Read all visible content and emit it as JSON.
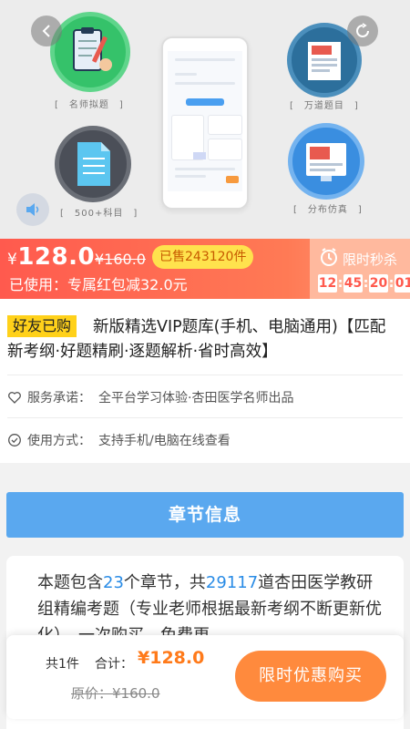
{
  "banner": {
    "captions": [
      "[　名师拟题　]",
      "[　万道题目　]",
      "[　500+科目　]",
      "[　分布仿真　]"
    ]
  },
  "price": {
    "current_symbol": "¥",
    "current_value": "128.0",
    "original": "¥160.0",
    "sold_badge": "已售243120件",
    "coupon_text": "已使用：专属红包减32.0元"
  },
  "flash_sale": {
    "title": "限时秒杀",
    "countdown": [
      "12",
      "45",
      "20",
      "01"
    ]
  },
  "product": {
    "friend_tag": "好友已购",
    "title": "新版精选VIP题库(手机、电脑通用)【匹配新考纲·好题精刷·逐题解析·省时高效】",
    "service_label": "服务承诺：",
    "service_value": "全平台学习体验·杏田医学名师出品",
    "usage_label": "使用方式：",
    "usage_value": "支持手机/电脑在线查看"
  },
  "chapter_button": "章节信息",
  "description": {
    "p1": "本题包含",
    "chapters": "23",
    "p2": "个章节，共",
    "questions": "29117",
    "p3": "道杏田医学教研组精编考题（专业老师根据最新考纲不断更新优化），一次购买，免费更"
  },
  "bottom_bar": {
    "count": "共1件",
    "total_label": "合计：",
    "total": "¥128.0",
    "original": "原价：¥160.0",
    "buy_button": "限时优惠购买"
  },
  "colors": {
    "price_gradient_start": "#ff5a4e",
    "chapter_button": "#5aa8ef",
    "buy_button": "#ff8a3d",
    "highlight": "#2a8ce6"
  },
  "icons": [
    "back-arrow-icon",
    "share-icon",
    "sound-icon",
    "clock-icon",
    "heart-icon",
    "check-circle-icon"
  ]
}
